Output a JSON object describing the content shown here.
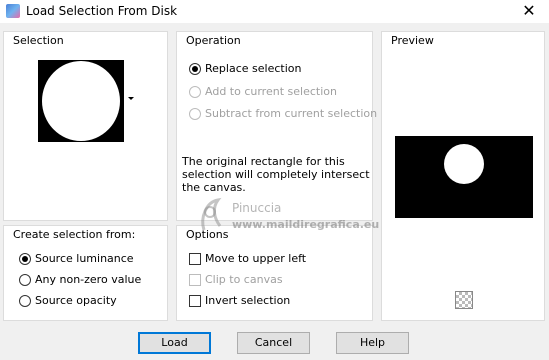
{
  "window": {
    "title": "Load Selection From Disk",
    "close_glyph": "✕"
  },
  "selection_group": {
    "title": "Selection"
  },
  "operation_group": {
    "title": "Operation",
    "options": [
      {
        "label": "Replace selection",
        "checked": true,
        "enabled": true
      },
      {
        "label": "Add to current selection",
        "checked": false,
        "enabled": false
      },
      {
        "label": "Subtract from current selection",
        "checked": false,
        "enabled": false
      }
    ],
    "info_text": "The original rectangle for this selection will completely intersect the canvas."
  },
  "preview_group": {
    "title": "Preview"
  },
  "create_group": {
    "title": "Create selection from:",
    "options": [
      {
        "label": "Source luminance",
        "checked": true
      },
      {
        "label": "Any non-zero value",
        "checked": false
      },
      {
        "label": "Source opacity",
        "checked": false
      }
    ]
  },
  "options_group": {
    "title": "Options",
    "options": [
      {
        "label": "Move to upper left",
        "checked": false,
        "enabled": true
      },
      {
        "label": "Clip to canvas",
        "checked": false,
        "enabled": false
      },
      {
        "label": "Invert selection",
        "checked": false,
        "enabled": true
      }
    ]
  },
  "watermark": {
    "name": "Pinuccia",
    "url": "www.maildiregrafica.eu"
  },
  "buttons": {
    "load": "Load",
    "cancel": "Cancel",
    "help": "Help"
  },
  "colors": {
    "accent": "#0078d7",
    "disabled": "#a0a0a0",
    "panel": "#f0f0f0"
  }
}
